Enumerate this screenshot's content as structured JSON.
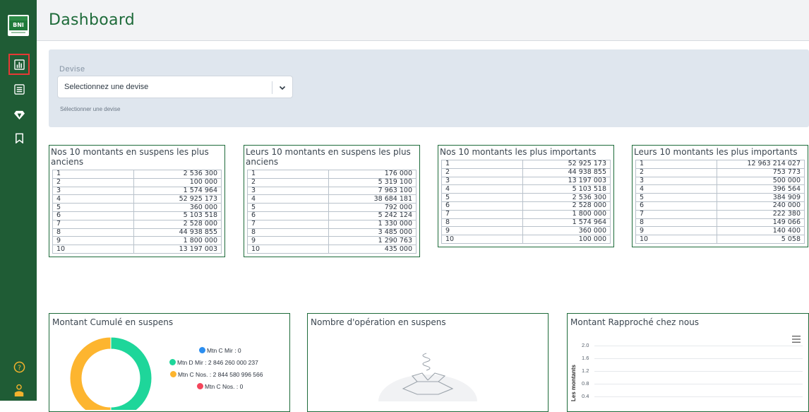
{
  "brand": {
    "logo_text": "BNI"
  },
  "header": {
    "title": "Dashboard"
  },
  "sidebar": {
    "items": [
      {
        "icon": "bar-chart-icon",
        "active": true
      },
      {
        "icon": "list-icon",
        "active": false
      },
      {
        "icon": "diamond-icon",
        "active": false
      },
      {
        "icon": "bookmark-icon",
        "active": false
      }
    ],
    "bottom": [
      {
        "icon": "help-icon"
      },
      {
        "icon": "user-icon"
      }
    ]
  },
  "filter": {
    "label": "Devise",
    "select_value": "Selectionnez une devise",
    "help": "Sélectionner une devise"
  },
  "tables": [
    {
      "title": "Nos 10 montants en suspens les plus anciens",
      "rows": [
        [
          "1",
          "2 536 300"
        ],
        [
          "2",
          "100 000"
        ],
        [
          "3",
          "1 574 964"
        ],
        [
          "4",
          "52 925 173"
        ],
        [
          "5",
          "360 000"
        ],
        [
          "6",
          "5 103 518"
        ],
        [
          "7",
          "2 528 000"
        ],
        [
          "8",
          "44 938 855"
        ],
        [
          "9",
          "1 800 000"
        ],
        [
          "10",
          "13 197 003"
        ]
      ]
    },
    {
      "title": "Leurs 10 montants en suspens les plus anciens",
      "rows": [
        [
          "1",
          "176 000"
        ],
        [
          "2",
          "5 319 100"
        ],
        [
          "3",
          "7 963 100"
        ],
        [
          "4",
          "38 684 181"
        ],
        [
          "5",
          "792 000"
        ],
        [
          "6",
          "5 242 124"
        ],
        [
          "7",
          "1 330 000"
        ],
        [
          "8",
          "3 485 000"
        ],
        [
          "9",
          "1 290 763"
        ],
        [
          "10",
          "435 000"
        ]
      ]
    },
    {
      "title": "Nos 10 montants les plus importants",
      "rows": [
        [
          "1",
          "52 925 173"
        ],
        [
          "2",
          "44 938 855"
        ],
        [
          "3",
          "13 197 003"
        ],
        [
          "4",
          "5 103 518"
        ],
        [
          "5",
          "2 536 300"
        ],
        [
          "6",
          "2 528 000"
        ],
        [
          "7",
          "1 800 000"
        ],
        [
          "8",
          "1 574 964"
        ],
        [
          "9",
          "360 000"
        ],
        [
          "10",
          "100 000"
        ]
      ]
    },
    {
      "title": "Leurs 10 montants les plus importants",
      "rows": [
        [
          "1",
          "12 963 214 027"
        ],
        [
          "2",
          "753 773"
        ],
        [
          "3",
          "500 000"
        ],
        [
          "4",
          "396 564"
        ],
        [
          "5",
          "384 909"
        ],
        [
          "6",
          "240 000"
        ],
        [
          "7",
          "222 380"
        ],
        [
          "8",
          "149 066"
        ],
        [
          "9",
          "140 400"
        ],
        [
          "10",
          "5 058"
        ]
      ]
    }
  ],
  "charts": {
    "cumul": {
      "title": "Montant Cumulé en suspens",
      "legend": [
        {
          "label": "Mtn C Mir : 0",
          "color": "#2b8ef0"
        },
        {
          "label": "Mtn D Mir : 2 846 260 000 237",
          "color": "#1ed69a"
        },
        {
          "label": "Mtn C Nos. : 2 844 580 996 566",
          "color": "#fdb52f"
        },
        {
          "label": "Mtn C Nos. : 0",
          "color": "#f4455b"
        }
      ]
    },
    "count": {
      "title": "Nombre d'opération en suspens"
    },
    "rapproche": {
      "title": "Montant Rapproché chez nous",
      "y_title": "Les montants",
      "y_ticks": [
        "2.0",
        "1.6",
        "1.2",
        "0.8",
        "0.4"
      ]
    }
  },
  "chart_data": {
    "type": "pie",
    "title": "Montant Cumulé en suspens",
    "categories": [
      "Mtn C Mir",
      "Mtn D Mir",
      "Mtn C Nos.",
      "Mtn C Nos."
    ],
    "values": [
      0,
      2846260000237,
      2844580996566,
      0
    ],
    "colors": [
      "#2b8ef0",
      "#1ed69a",
      "#fdb52f",
      "#f4455b"
    ],
    "legend": "right"
  }
}
